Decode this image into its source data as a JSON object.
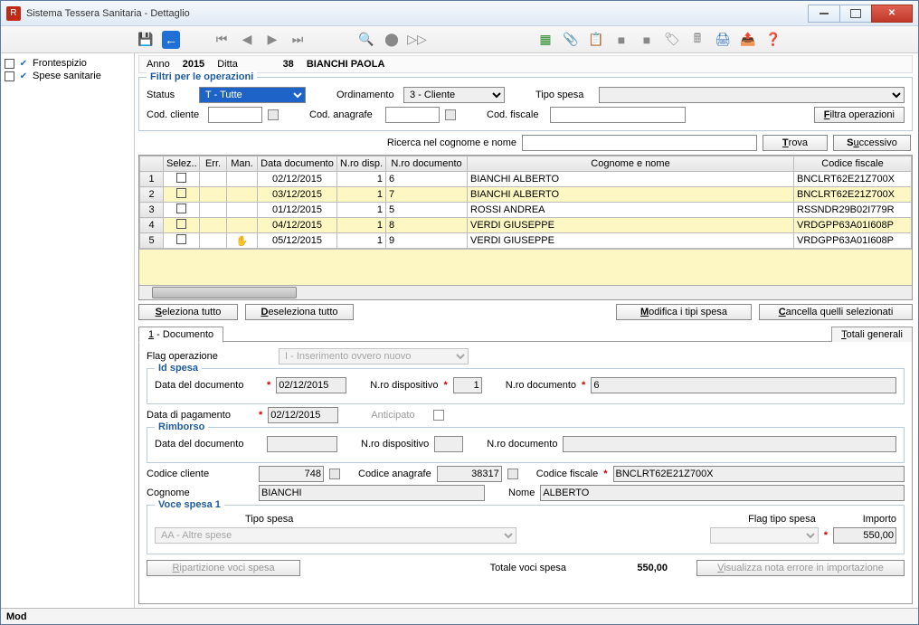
{
  "window": {
    "title": "Sistema Tessera Sanitaria - Dettaglio"
  },
  "tree": {
    "items": [
      "Frontespizio",
      "Spese sanitarie"
    ]
  },
  "header": {
    "anno_lbl": "Anno",
    "anno": "2015",
    "ditta_lbl": "Ditta",
    "ditta": "38",
    "nome": "BIANCHI PAOLA"
  },
  "filters": {
    "legend": "Filtri per le operazioni",
    "status_lbl": "Status",
    "status_val": "T  - Tutte",
    "ord_lbl": "Ordinamento",
    "ord_val": "3  - Cliente",
    "tipo_lbl": "Tipo spesa",
    "tipo_val": "",
    "codcli_lbl": "Cod. cliente",
    "codcli": "",
    "codana_lbl": "Cod. anagrafe",
    "codana": "",
    "codfis_lbl": "Cod. fiscale",
    "codfis": "",
    "filtra_btn": "Filtra operazioni"
  },
  "search": {
    "label": "Ricerca nel cognome e nome",
    "value": "",
    "trova": "Trova",
    "succ": "Successivo"
  },
  "table": {
    "cols": [
      "Selez..",
      "Err.",
      "Man.",
      "Data documento",
      "N.ro disp.",
      "N.ro documento",
      "Cognome e nome",
      "Codice fiscale"
    ],
    "rows": [
      {
        "n": "1",
        "man": "",
        "data": "02/12/2015",
        "disp": "1",
        "doc": "6",
        "nome": "BIANCHI ALBERTO",
        "cf": "BNCLRT62E21Z700X",
        "y": false
      },
      {
        "n": "2",
        "man": "",
        "data": "03/12/2015",
        "disp": "1",
        "doc": "7",
        "nome": "BIANCHI ALBERTO",
        "cf": "BNCLRT62E21Z700X",
        "y": true
      },
      {
        "n": "3",
        "man": "",
        "data": "01/12/2015",
        "disp": "1",
        "doc": "5",
        "nome": "ROSSI ANDREA",
        "cf": "RSSNDR29B02I779R",
        "y": false
      },
      {
        "n": "4",
        "man": "",
        "data": "04/12/2015",
        "disp": "1",
        "doc": "8",
        "nome": "VERDI GIUSEPPE",
        "cf": "VRDGPP63A01I608P",
        "y": true
      },
      {
        "n": "5",
        "man": "✋",
        "data": "05/12/2015",
        "disp": "1",
        "doc": "9",
        "nome": "VERDI GIUSEPPE",
        "cf": "VRDGPP63A01I608P",
        "y": false
      }
    ]
  },
  "actions": {
    "sel_all": "Seleziona tutto",
    "desel_all": "Deseleziona tutto",
    "mod_tipi": "Modifica i tipi spesa",
    "canc_sel": "Cancella quelli selezionati"
  },
  "tabs": {
    "doc": "1 - Documento",
    "totali": "Totali generali"
  },
  "detail": {
    "flagop_lbl": "Flag operazione",
    "flagop": "I  - Inserimento ovvero nuovo",
    "idspesa": "Id spesa",
    "datadoc_lbl": "Data del documento",
    "datadoc": "02/12/2015",
    "ndisp_lbl": "N.ro dispositivo",
    "ndisp": "1",
    "ndoc_lbl": "N.ro documento",
    "ndoc": "6",
    "datapag_lbl": "Data di pagamento",
    "datapag": "02/12/2015",
    "antic_lbl": "Anticipato",
    "rimborso": "Rimborso",
    "r_datadoc_lbl": "Data del documento",
    "r_datadoc": "",
    "r_ndisp_lbl": "N.ro dispositivo",
    "r_ndisp": "",
    "r_ndoc_lbl": "N.ro documento",
    "r_ndoc": "",
    "codcli_lbl": "Codice cliente",
    "codcli": "748",
    "codana_lbl": "Codice anagrafe",
    "codana": "38317",
    "codfis_lbl": "Codice fiscale",
    "codfis": "BNCLRT62E21Z700X",
    "cogn_lbl": "Cognome",
    "cogn": "BIANCHI",
    "nome_lbl": "Nome",
    "nome": "ALBERTO",
    "voce": "Voce spesa 1",
    "tipospesa_lbl": "Tipo spesa",
    "tipospesa": "AA - Altre spese",
    "flagtipo_lbl": "Flag tipo spesa",
    "flagtipo": "",
    "importo_lbl": "Importo",
    "importo": "550,00",
    "ripart_btn": "Ripartizione voci spesa",
    "totvoci_lbl": "Totale voci spesa",
    "totvoci": "550,00",
    "visnota_btn": "Visualizza nota errore in importazione"
  },
  "status": {
    "mod": "Mod"
  }
}
